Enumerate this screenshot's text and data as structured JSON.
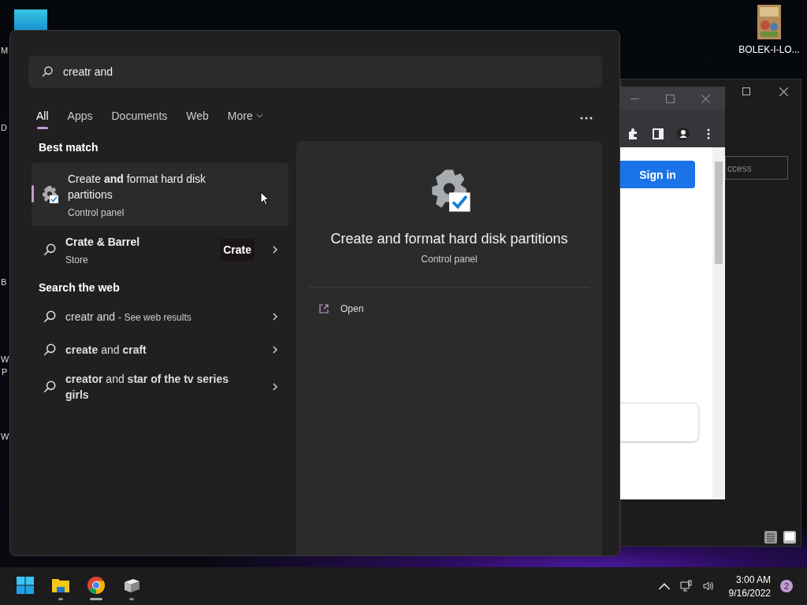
{
  "desktop": {
    "icons": [
      {
        "label": "BOLEK-I-LO..."
      }
    ],
    "edge_labels": [
      "M",
      "D",
      "B",
      "W",
      "P",
      "W"
    ]
  },
  "background_windows": {
    "settings_window": {
      "field_value": "ccess"
    },
    "browser": {
      "button": "Sign in"
    }
  },
  "start_search": {
    "query": "creatr and",
    "tabs": [
      {
        "label": "All",
        "selected": true
      },
      {
        "label": "Apps",
        "selected": false
      },
      {
        "label": "Documents",
        "selected": false
      },
      {
        "label": "Web",
        "selected": false
      },
      {
        "label": "More",
        "selected": false,
        "kind": "dropdown"
      }
    ],
    "best_match": {
      "heading": "Best match",
      "items": [
        {
          "kind": "app",
          "title": "Create **and** format hard disk partitions",
          "subtitle": "Control panel",
          "selected": true
        },
        {
          "kind": "store",
          "title": "Crate & Barrel",
          "subtitle": "Store",
          "badge": "Crate",
          "selected": false
        }
      ]
    },
    "web": {
      "heading": "Search the web",
      "items": [
        {
          "text": "creatr and",
          "suffix": "- See web results"
        },
        {
          "text": "**create** and **craft**"
        },
        {
          "text": "**creator** and **star of the tv series girls**"
        }
      ]
    },
    "preview": {
      "title": "Create and format hard disk partitions",
      "subtitle": "Control panel",
      "actions": [
        {
          "label": "Open"
        }
      ]
    }
  },
  "taskbar": {
    "apps": [
      {
        "kind": "start",
        "running": false,
        "active": false
      },
      {
        "kind": "explorer",
        "running": true,
        "active": false
      },
      {
        "kind": "chrome",
        "running": true,
        "active": true
      },
      {
        "kind": "box",
        "running": true,
        "active": false
      }
    ],
    "time": "3:00 AM",
    "date": "9/16/2022",
    "notifications": "2"
  }
}
